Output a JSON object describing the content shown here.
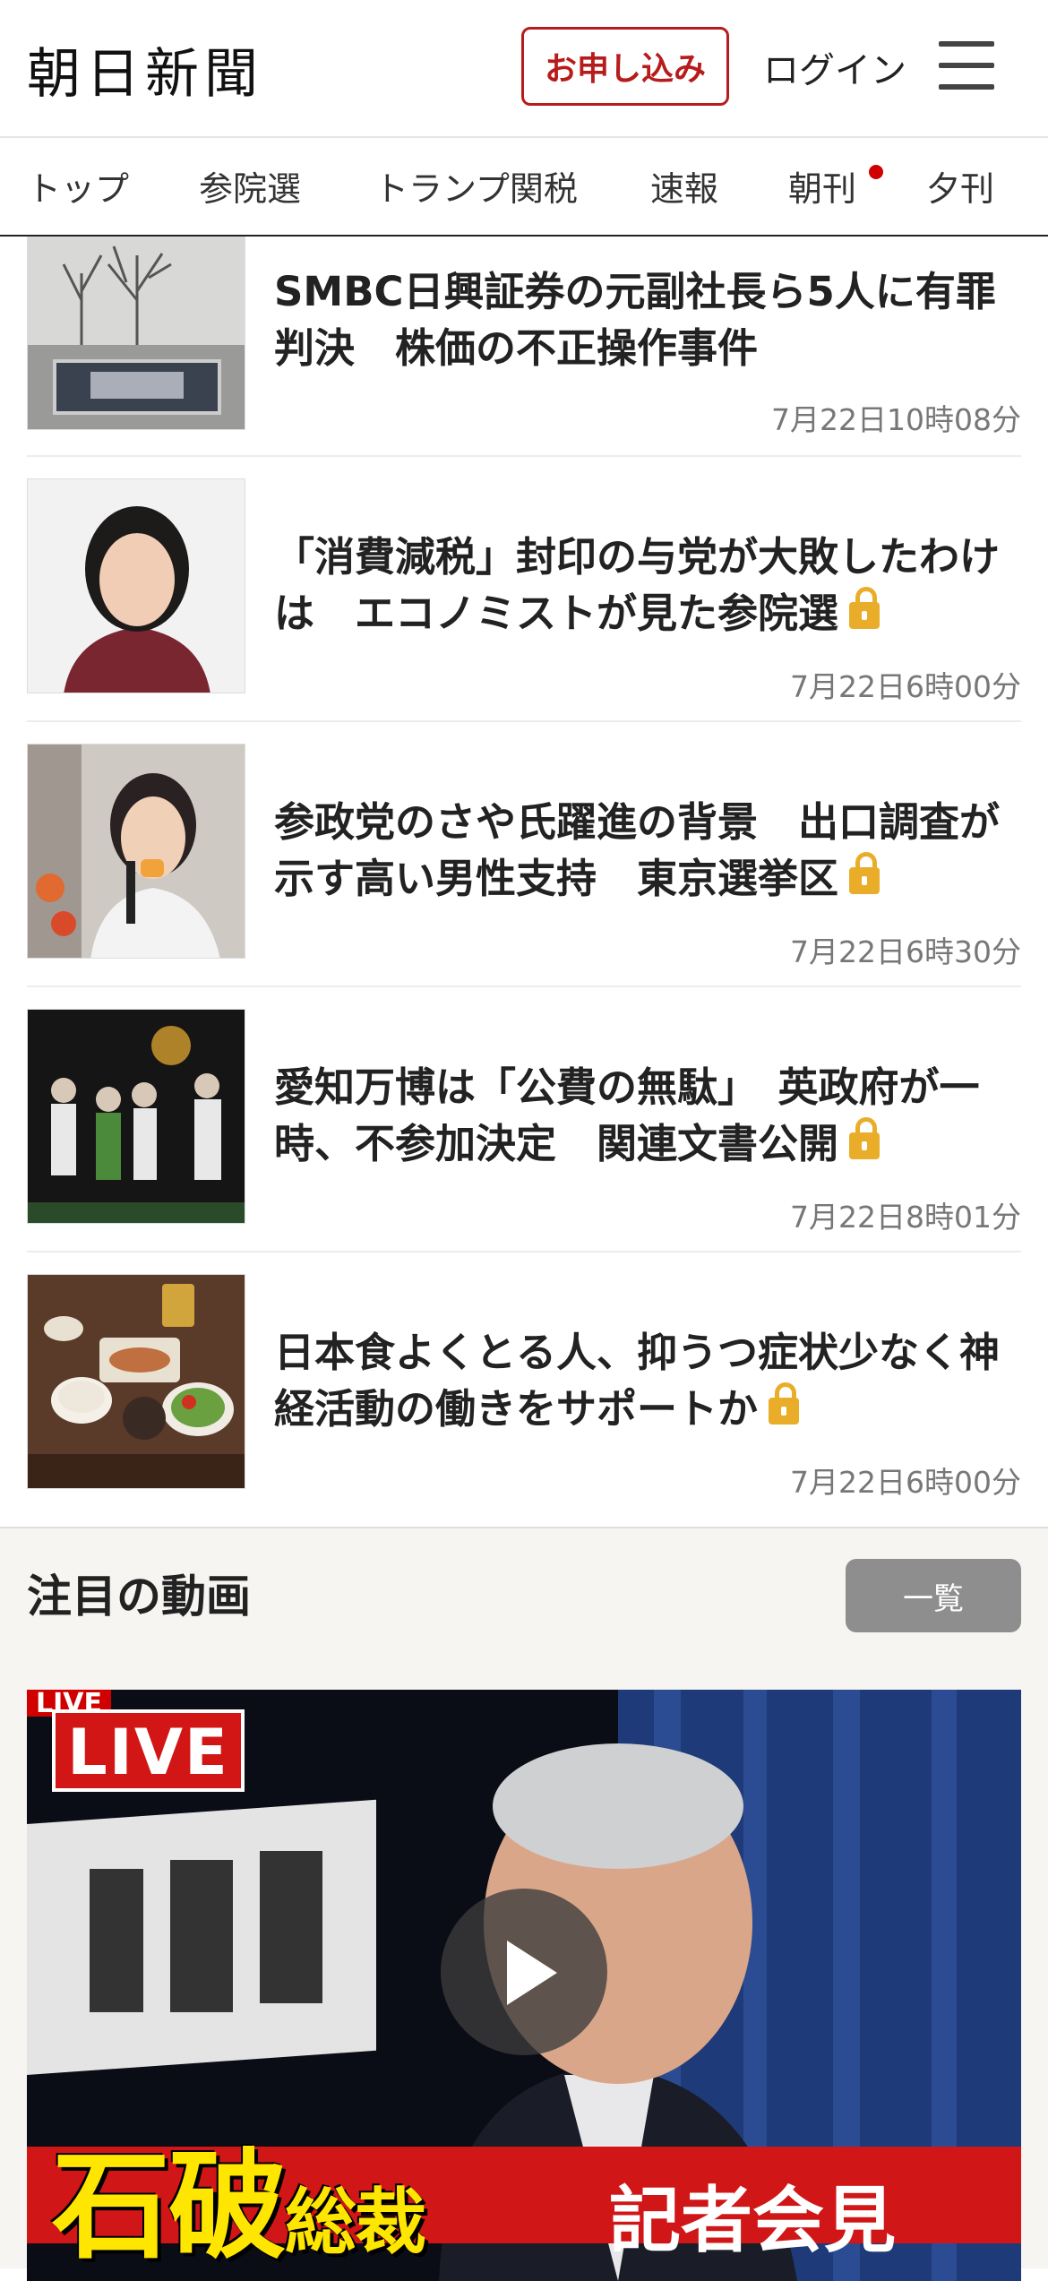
{
  "header": {
    "logo": "朝日新聞",
    "apply_label": "お申し込み",
    "login_label": "ログイン",
    "menu_icon": "hamburger-menu-icon"
  },
  "nav": {
    "tabs": [
      {
        "label": "トップ"
      },
      {
        "label": "参院選"
      },
      {
        "label": "トランプ関税"
      },
      {
        "label": "速報"
      },
      {
        "label": "朝刊",
        "has_dot": true
      },
      {
        "label": "夕刊"
      }
    ]
  },
  "articles": [
    {
      "title": "SMBC日興証券の元副社長ら5人に有罪判決　株価の不正操作事件",
      "time": "7月22日10時08分",
      "locked": false
    },
    {
      "title": "「消費減税」封印の与党が大敗したわけは　エコノミストが見た参院選",
      "time": "7月22日6時00分",
      "locked": true
    },
    {
      "title": "参政党のさや氏躍進の背景　出口調査が示す高い男性支持　東京選挙区",
      "time": "7月22日6時30分",
      "locked": true
    },
    {
      "title": "愛知万博は「公費の無駄」　英政府が一時、不参加決定　関連文書公開",
      "time": "7月22日8時01分",
      "locked": true
    },
    {
      "title": "日本食よくとる人、抑うつ症状少なく神経活動の働きをサポートか",
      "time": "7月22日6時00分",
      "locked": true
    }
  ],
  "video_section": {
    "heading": "注目の動画",
    "list_button": "一覧",
    "video": {
      "live_small": "LIVE",
      "live_badge": "LIVE",
      "caption_main_big": "石破",
      "caption_main_small": "総裁",
      "caption_sub": "記者会見",
      "play_icon": "play-icon"
    }
  },
  "colors": {
    "brand_red": "#b71c1c",
    "lock_yellow": "#e9ad2a",
    "live_red": "#d21515"
  }
}
